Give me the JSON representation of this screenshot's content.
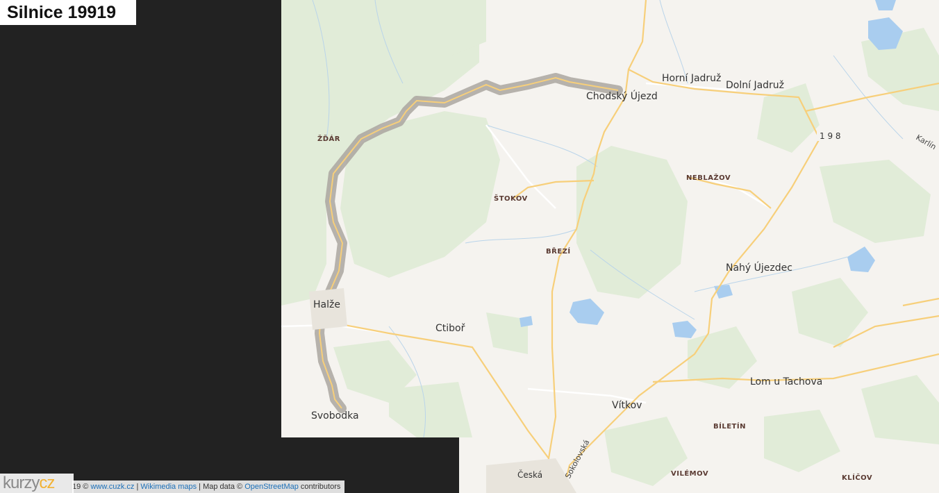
{
  "title": "Silnice 19919",
  "map": {
    "places_large": [
      {
        "name": "Chodský Újezd"
      },
      {
        "name": "Horní Jadruž"
      },
      {
        "name": "Dolní Jadruž"
      },
      {
        "name": "Halže"
      },
      {
        "name": "Ctiboř"
      },
      {
        "name": "Nahý Újezdec"
      },
      {
        "name": "Lom u Tachova"
      },
      {
        "name": "Vítkov"
      },
      {
        "name": "Svobodka"
      },
      {
        "name": "Česká"
      }
    ],
    "places_small": [
      {
        "name": "ŽĎÁR"
      },
      {
        "name": "ŠTOKOV"
      },
      {
        "name": "BŘEZÍ"
      },
      {
        "name": "NEBLAŽOV"
      },
      {
        "name": "BÍLETÍN"
      },
      {
        "name": "VILÉMOV"
      },
      {
        "name": "KLÍČOV"
      }
    ],
    "road_number": "1 9 8",
    "street_labels": [
      "Sokolovská",
      "Karlín"
    ]
  },
  "attribution": {
    "prefix": "19 ©",
    "cuzk_link": "www.cuzk.cz",
    "separator1": "|",
    "wikimedia_link": "Wikimedia maps",
    "separator2": "| Map data ©",
    "osm_link": "OpenStreetMap",
    "suffix": "contributors"
  },
  "logo": {
    "part1": "kurzy",
    "part2": "cz"
  },
  "colors": {
    "background": "#222222",
    "map_land": "#f5f3ef",
    "forest": "#e0ebd8",
    "water": "#a9cdef",
    "road_major": "#f7cf7a",
    "route_highlight": "#aaa6a0"
  }
}
